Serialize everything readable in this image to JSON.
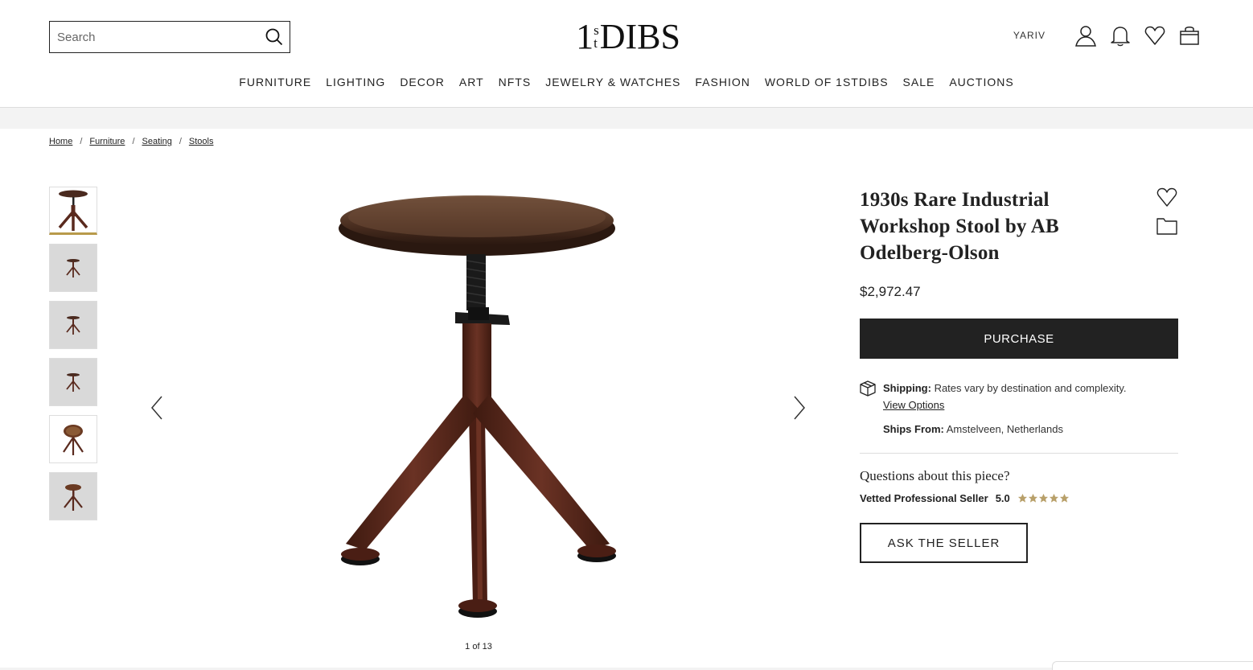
{
  "header": {
    "search_placeholder": "Search",
    "logo": {
      "one": "1",
      "s": "s",
      "t": "t",
      "dibs": "DIBS"
    },
    "user_name": "YARIV",
    "icons": [
      "user-icon",
      "bell-icon",
      "heart-icon",
      "bag-icon"
    ]
  },
  "nav": {
    "items": [
      {
        "label": "FURNITURE"
      },
      {
        "label": "LIGHTING"
      },
      {
        "label": "DECOR"
      },
      {
        "label": "ART"
      },
      {
        "label": "NFTS"
      },
      {
        "label": "JEWELRY & WATCHES"
      },
      {
        "label": "FASHION"
      },
      {
        "label": "WORLD OF 1STDIBS"
      },
      {
        "label": "SALE"
      },
      {
        "label": "AUCTIONS"
      }
    ]
  },
  "breadcrumb": {
    "items": [
      {
        "label": "Home"
      },
      {
        "label": "Furniture"
      },
      {
        "label": "Seating"
      },
      {
        "label": "Stools"
      }
    ],
    "separator": "/"
  },
  "gallery": {
    "counter": "1 of 13",
    "active_thumbnail": 1,
    "thumbnail_count": 6
  },
  "product": {
    "title": "1930s Rare Industrial Workshop Stool by AB Odelberg-Olson",
    "price": "$2,972.47",
    "purchase_label": "PURCHASE",
    "shipping_label": "Shipping:",
    "shipping_text": "Rates vary by destination and complexity.",
    "view_options": "View Options",
    "ships_from_label": "Ships From:",
    "ships_from_value": "Amstelveen, Netherlands",
    "questions": "Questions about this piece?",
    "seller_label": "Vetted Professional Seller",
    "seller_rating": "5.0",
    "stars": 5,
    "ask_label": "ASK THE SELLER"
  },
  "colors": {
    "primary": "#222222",
    "accent_gold": "#b89a4a",
    "star": "#b8a06a",
    "stool_brown": "#5a2a1e"
  }
}
